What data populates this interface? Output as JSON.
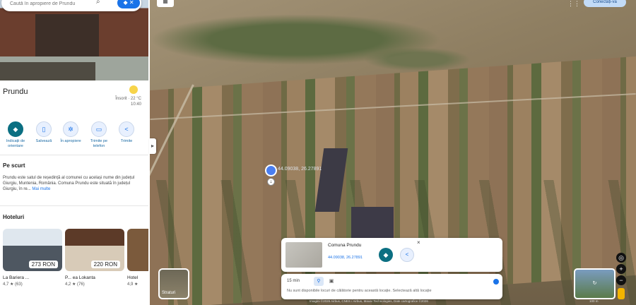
{
  "search": {
    "placeholder": "Caută în apropiere de Prundu"
  },
  "place": {
    "title": "Prundu",
    "weather_line1": "Însorit · 22 °C",
    "weather_line2": "10:40"
  },
  "actions": [
    {
      "label": "Indicații de orientare",
      "icon": "directions-icon"
    },
    {
      "label": "Salvează",
      "icon": "bookmark-icon"
    },
    {
      "label": "În apropiere",
      "icon": "nearby-icon"
    },
    {
      "label": "Trimite pe telefon",
      "icon": "phone-icon"
    },
    {
      "label": "Trimite",
      "icon": "share-icon"
    }
  ],
  "about": {
    "heading": "Pe scurt",
    "text": "Prundu este satul de reședință al comunei cu același nume din județul Giurgiu, Muntenia, România. Comuna Prundu este situată în județul Giurgiu, în re...",
    "more": "Mai multe"
  },
  "hotels": {
    "heading": "Hoteluri",
    "items": [
      {
        "price": "273 RON",
        "name": "La Bariera ... ",
        "rating": "4,7 ★ (63)"
      },
      {
        "price": "220 RON",
        "name": "P... ea Lokanta",
        "rating": "4,2 ★ (76)"
      },
      {
        "price": "",
        "name": "Hotel",
        "rating": "4,9 ★"
      }
    ]
  },
  "map": {
    "pin_label": "44.09038, 26.27891",
    "layers_label": "Straturi",
    "signin_label": "Conectați-vă"
  },
  "card": {
    "title": "Comuna Prundu",
    "coords": "44.09038, 26.27891",
    "close": "×"
  },
  "travel": {
    "time": "15 min",
    "note": "Nu sunt disponibile locuri de călătorie pentru această locație. Selectează altă locație"
  },
  "footer": {
    "attribution": "Imagini ©2026 Airbus, CNES / Airbus, Maxar Technologies, Date cartografice ©2026",
    "scale": "100 m"
  },
  "colors": {
    "accent": "#1a73e8",
    "primary_action": "#0b6f82"
  }
}
